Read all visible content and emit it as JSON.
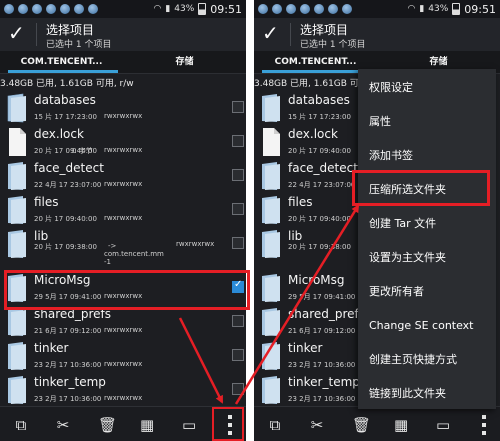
{
  "status_bar": {
    "battery": "43%",
    "time": "09:51"
  },
  "action_bar": {
    "title": "选择项目",
    "subtitle": "已选中 1 个项目"
  },
  "tabs": [
    {
      "label": "COM.TENCENT..."
    },
    {
      "label": "存储"
    }
  ],
  "storage_info": "3.48GB 已用, 1.61GB 可用, r/w",
  "files": [
    {
      "name": "databases",
      "date": "15 片 17 17:23:00",
      "perm": "rwxrwxrwx",
      "kind": "folder"
    },
    {
      "name": "dex.lock",
      "date": "20 片 17 09:40:00",
      "size": "0 字节",
      "perm": "rwxrwxrwx",
      "kind": "file"
    },
    {
      "name": "face_detect",
      "date": "22 4月 17 23:07:00",
      "perm": "rwxrwxrwx",
      "kind": "folder"
    },
    {
      "name": "files",
      "date": "20 片 17 09:40:00",
      "perm": "rwxrwxrwx",
      "kind": "folder"
    },
    {
      "name": "lib",
      "date": "20 片 17 09:38:00",
      "link": "->",
      "link_target": "com.tencent.mm",
      "link_suffix": "-1",
      "perm": "rwxrwxrwx",
      "kind": "folder"
    },
    {
      "name": "MicroMsg",
      "date": "29 5月 17 09:41:00",
      "perm": "rwxrwxrwx",
      "kind": "folder",
      "checked": true
    },
    {
      "name": "shared_prefs",
      "date": "21 6月 17 09:12:00",
      "perm": "rwxrwxrwx",
      "kind": "folder"
    },
    {
      "name": "tinker",
      "date": "23 2月 17 10:36:00",
      "perm": "rwxrwxrwx",
      "kind": "folder"
    },
    {
      "name": "tinker_temp",
      "date": "23 2月 17 10:36:00",
      "perm": "rwxrwxrwx",
      "kind": "folder"
    }
  ],
  "context_menu": {
    "items": [
      "权限设定",
      "属性",
      "添加书签",
      "压缩所选文件夹",
      "创建 Tar 文件",
      "设置为主文件夹",
      "更改所有者",
      "Change SE context",
      "创建主页快捷方式",
      "链接到此文件夹"
    ]
  },
  "bottom_bar": {
    "icons": [
      "copy-icon",
      "cut-icon",
      "delete-icon",
      "select-all-icon",
      "more-icon"
    ]
  },
  "colors": {
    "highlight": "#e51e25",
    "accent": "#3aa0d8",
    "checkbox": "#2b8ad6"
  }
}
